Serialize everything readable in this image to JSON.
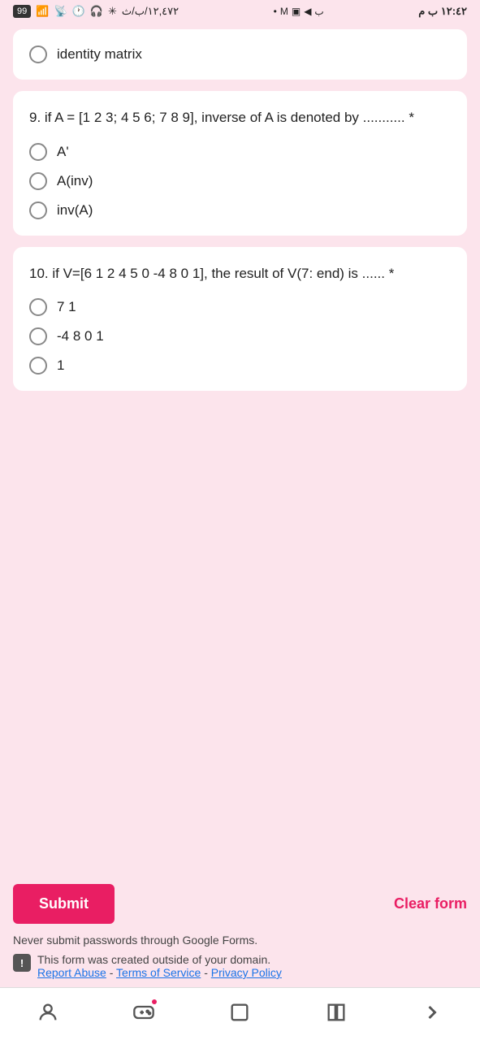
{
  "statusBar": {
    "battery": "99",
    "time": "١٢:٤٢ ب م",
    "carrier": "١٢,٤٧٢/ب/ث"
  },
  "prevQuestion": {
    "answer": "identity matrix"
  },
  "question9": {
    "number": "9",
    "text": "9. if A = [1 2 3; 4 5 6; 7 8 9], inverse of A is denoted by ........... *",
    "options": [
      {
        "id": "q9a",
        "label": "A'"
      },
      {
        "id": "q9b",
        "label": "A(inv)"
      },
      {
        "id": "q9c",
        "label": "inv(A)"
      }
    ]
  },
  "question10": {
    "number": "10",
    "text": "10. if V=[6 1 2 4 5 0 -4 8 0 1], the result of V(7: end) is ...... *",
    "options": [
      {
        "id": "q10a",
        "label": "7 1"
      },
      {
        "id": "q10b",
        "label": "-4 8 0 1"
      },
      {
        "id": "q10c",
        "label": "1"
      }
    ]
  },
  "buttons": {
    "submit": "Submit",
    "clearForm": "Clear form"
  },
  "footer": {
    "neverSubmit": "Never submit passwords through Google Forms.",
    "warningText": "This form was created outside of your domain.",
    "links": {
      "reportAbuse": "Report Abuse",
      "termsOfService": "Terms of Service",
      "privacyPolicy": "Privacy Policy"
    }
  }
}
